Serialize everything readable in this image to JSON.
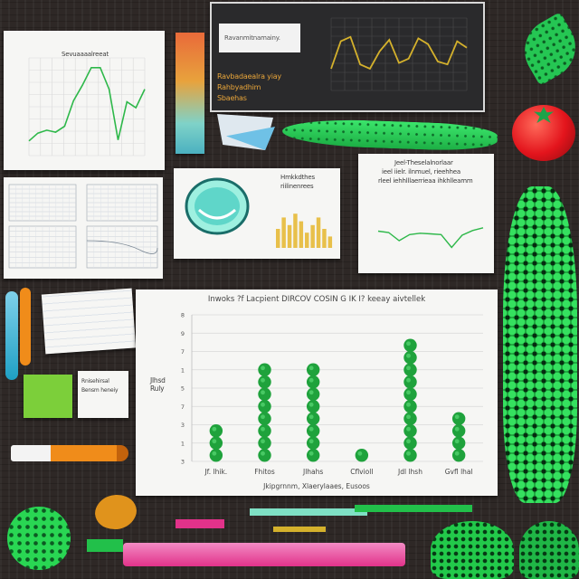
{
  "colors": {
    "background": "#2e2826",
    "paper": "#f6f6f4",
    "chart_green": "#1fa23c",
    "line_green": "#2eb84a",
    "leaf_green": "#22d04a",
    "tomato_red": "#e3141c",
    "pink": "#e2328a",
    "orange": "#f08c1a",
    "gold_line": "#d4b12c"
  },
  "main_chart": {
    "title": "Inwoks ?f Lacpient DIRCOV COSIN G IK I? keeay aivtellek",
    "ylabel": "Jlhsd Ruly",
    "xcaption": "Jkipgrnnm, Xlaerylaaes, Eusoos",
    "chart_data": {
      "type": "scatter",
      "categories": [
        "Jf. lhik.",
        "Fhitos",
        "Jlhahs",
        "Cflvioll",
        "Jdl lhsh",
        "Gvfl lhal"
      ],
      "y_ticks": [
        "8",
        "9",
        "7",
        "1",
        "5",
        "7",
        "3",
        "1",
        "3"
      ],
      "values": [
        3,
        8,
        8,
        1,
        10,
        4
      ],
      "ylim": [
        0,
        12
      ]
    }
  },
  "top_left_chart": {
    "title": "Sevuaaaalreeat",
    "chart_data": {
      "type": "line",
      "values": [
        1.5,
        2.3,
        2.6,
        2.4,
        3.0,
        5.6,
        7.2,
        9.0,
        9.0,
        6.8,
        1.6,
        5.5,
        4.9,
        6.8
      ],
      "ylim": [
        0,
        10
      ]
    }
  },
  "top_monitor": {
    "label": "Ravanmitnamainy.",
    "caption_lines": [
      "Ravbadaealra yiay",
      "Rahbyadhim",
      "Sbaehas"
    ],
    "chart_data": {
      "type": "line",
      "values": [
        3.0,
        6.8,
        7.4,
        3.6,
        3.0,
        5.4,
        7.0,
        3.8,
        4.4,
        7.2,
        6.4,
        4.0,
        3.6,
        6.8,
        5.9
      ],
      "ylim": [
        0,
        10
      ]
    }
  },
  "middle_right_chart": {
    "header_lines": [
      "Jeel-Theselalnorlaar",
      "ieel iielr. ilnmuel, rieehhea",
      "rleel iehhlllaerrieaa ihkhlleamm"
    ],
    "chart_data": {
      "type": "line",
      "values": [
        4.6,
        4.4,
        3.2,
        4.1,
        4.3,
        4.2,
        4.1,
        2.2,
        4.0,
        4.7,
        5.1
      ],
      "ylim": [
        0,
        8
      ]
    }
  },
  "lens_card": {
    "header_lines": [
      "Hmkkdthes",
      "riilinenrees"
    ],
    "chart_data": {
      "type": "bar",
      "values": [
        5,
        8,
        6,
        9,
        7,
        4,
        6,
        8,
        5,
        3
      ],
      "ylim": [
        0,
        10
      ]
    }
  },
  "sticky_note": {
    "lines": [
      "Rnisehirsal",
      "Bensm heneiy"
    ]
  }
}
